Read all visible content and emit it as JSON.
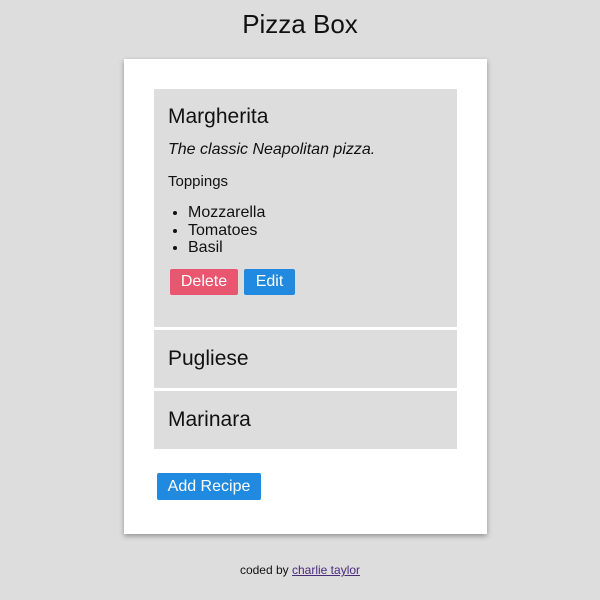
{
  "app": {
    "title": "Pizza Box"
  },
  "recipes": [
    {
      "name": "Margherita",
      "description": "The classic Neapolitan pizza.",
      "toppings_heading": "Toppings",
      "toppings": [
        "Mozzarella",
        "Tomatoes",
        "Basil"
      ],
      "delete_label": "Delete",
      "edit_label": "Edit"
    },
    {
      "name": "Pugliese"
    },
    {
      "name": "Marinara"
    }
  ],
  "actions": {
    "add_recipe_label": "Add Recipe"
  },
  "footer": {
    "prefix": "coded by",
    "author_link": "charlie taylor"
  },
  "colors": {
    "background": "#dddddd",
    "panel": "#ffffff",
    "delete_button": "#e8566f",
    "primary_button": "#1f8ae0",
    "link": "#4b2a7c"
  }
}
